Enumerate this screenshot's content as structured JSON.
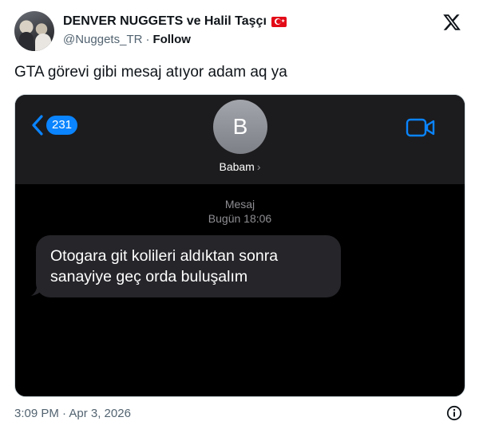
{
  "author": {
    "display_name": "DENVER NUGGETS ve Halil Taşçı",
    "handle": "@Nuggets_TR",
    "separator": "·",
    "follow_label": "Follow",
    "flag_icon": "turkey-flag-icon"
  },
  "tweet": {
    "text": "GTA görevi gibi mesaj atıyor adam aq ya"
  },
  "screenshot": {
    "back_count": "231",
    "contact_initial": "B",
    "contact_name": "Babam",
    "contact_chevron": "›",
    "service_label": "Mesaj",
    "timestamp": "Bugün 18:06",
    "message_line_1": "Otogara git kolileri aldıktan sonra",
    "message_line_2": "sanayiye geç orda buluşalım",
    "accent_color": "#0a84ff"
  },
  "footer": {
    "timestamp": "3:09 PM · Apr 3, 2026"
  }
}
